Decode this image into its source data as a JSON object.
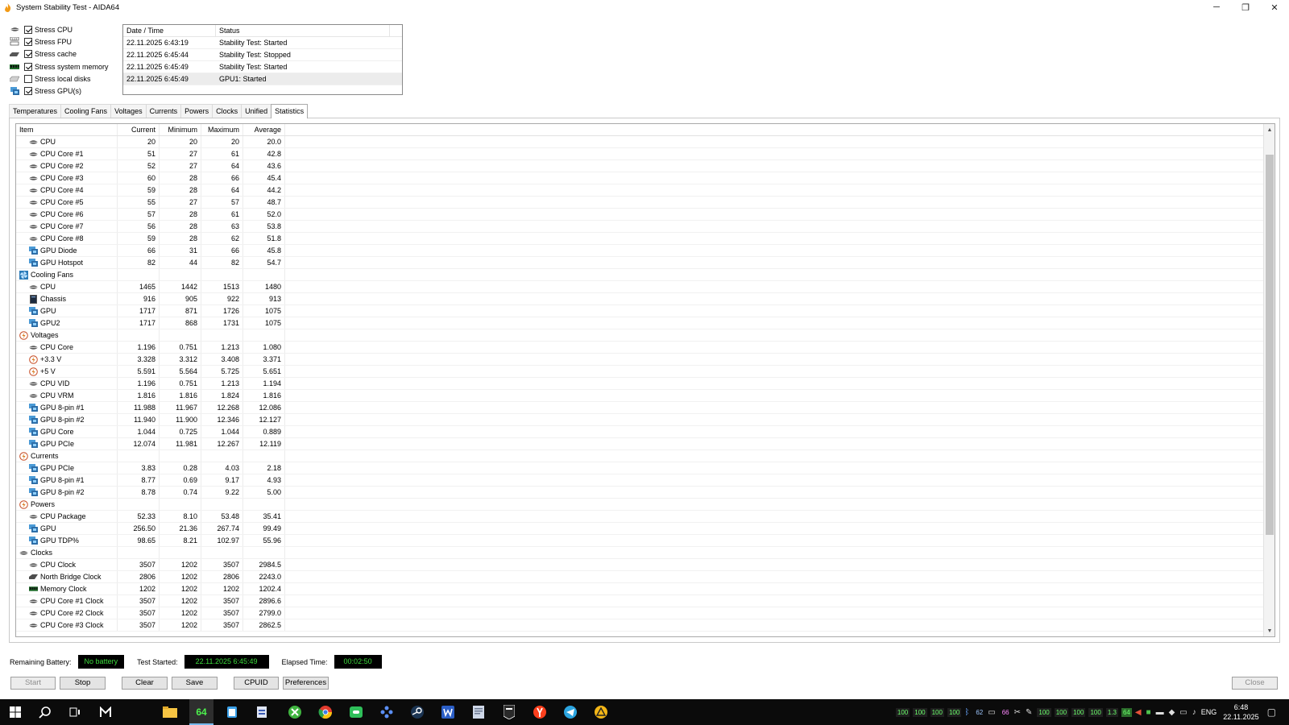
{
  "window": {
    "title": "System Stability Test - AIDA64",
    "minimize_glyph": "─",
    "restore_glyph": "❐",
    "close_glyph": "✕"
  },
  "stress_options": [
    {
      "label": "Stress CPU",
      "checked": true,
      "icon": "cpu-icon"
    },
    {
      "label": "Stress FPU",
      "checked": true,
      "icon": "fpu-icon"
    },
    {
      "label": "Stress cache",
      "checked": true,
      "icon": "cache-icon"
    },
    {
      "label": "Stress system memory",
      "checked": true,
      "icon": "memory-icon"
    },
    {
      "label": "Stress local disks",
      "checked": false,
      "icon": "disk-icon"
    },
    {
      "label": "Stress GPU(s)",
      "checked": true,
      "icon": "gpu-icon"
    }
  ],
  "log": {
    "headers": [
      "Date / Time",
      "Status"
    ],
    "rows": [
      {
        "datetime": "22.11.2025 6:43:19",
        "status": "Stability Test: Started"
      },
      {
        "datetime": "22.11.2025 6:45:44",
        "status": "Stability Test: Stopped"
      },
      {
        "datetime": "22.11.2025 6:45:49",
        "status": "Stability Test: Started"
      },
      {
        "datetime": "22.11.2025 6:45:49",
        "status": "GPU1: Started"
      }
    ]
  },
  "tabs": [
    "Temperatures",
    "Cooling Fans",
    "Voltages",
    "Currents",
    "Powers",
    "Clocks",
    "Unified",
    "Statistics"
  ],
  "active_tab": "Statistics",
  "stats": {
    "headers": {
      "item": "Item",
      "current": "Current",
      "minimum": "Minimum",
      "maximum": "Maximum",
      "average": "Average"
    },
    "rows": [
      {
        "name": "CPU",
        "level": 1,
        "icon": "cpu-icon",
        "cur": "20",
        "min": "20",
        "max": "20",
        "avg": "20.0"
      },
      {
        "name": "CPU Core #1",
        "level": 1,
        "icon": "cpu-icon",
        "cur": "51",
        "min": "27",
        "max": "61",
        "avg": "42.8"
      },
      {
        "name": "CPU Core #2",
        "level": 1,
        "icon": "cpu-icon",
        "cur": "52",
        "min": "27",
        "max": "64",
        "avg": "43.6"
      },
      {
        "name": "CPU Core #3",
        "level": 1,
        "icon": "cpu-icon",
        "cur": "60",
        "min": "28",
        "max": "66",
        "avg": "45.4"
      },
      {
        "name": "CPU Core #4",
        "level": 1,
        "icon": "cpu-icon",
        "cur": "59",
        "min": "28",
        "max": "64",
        "avg": "44.2"
      },
      {
        "name": "CPU Core #5",
        "level": 1,
        "icon": "cpu-icon",
        "cur": "55",
        "min": "27",
        "max": "57",
        "avg": "48.7"
      },
      {
        "name": "CPU Core #6",
        "level": 1,
        "icon": "cpu-icon",
        "cur": "57",
        "min": "28",
        "max": "61",
        "avg": "52.0"
      },
      {
        "name": "CPU Core #7",
        "level": 1,
        "icon": "cpu-icon",
        "cur": "56",
        "min": "28",
        "max": "63",
        "avg": "53.8"
      },
      {
        "name": "CPU Core #8",
        "level": 1,
        "icon": "cpu-icon",
        "cur": "59",
        "min": "28",
        "max": "62",
        "avg": "51.8"
      },
      {
        "name": "GPU Diode",
        "level": 1,
        "icon": "gpu-icon",
        "cur": "66",
        "min": "31",
        "max": "66",
        "avg": "45.8"
      },
      {
        "name": "GPU Hotspot",
        "level": 1,
        "icon": "gpu-icon",
        "cur": "82",
        "min": "44",
        "max": "82",
        "avg": "54.7"
      },
      {
        "name": "Cooling Fans",
        "level": 0,
        "icon": "fan-icon",
        "cur": "",
        "min": "",
        "max": "",
        "avg": ""
      },
      {
        "name": "CPU",
        "level": 1,
        "icon": "cpu-icon",
        "cur": "1465",
        "min": "1442",
        "max": "1513",
        "avg": "1480"
      },
      {
        "name": "Chassis",
        "level": 1,
        "icon": "chassis-icon",
        "cur": "916",
        "min": "905",
        "max": "922",
        "avg": "913"
      },
      {
        "name": "GPU",
        "level": 1,
        "icon": "gpu-icon",
        "cur": "1717",
        "min": "871",
        "max": "1726",
        "avg": "1075"
      },
      {
        "name": "GPU2",
        "level": 1,
        "icon": "gpu-icon",
        "cur": "1717",
        "min": "868",
        "max": "1731",
        "avg": "1075"
      },
      {
        "name": "Voltages",
        "level": 0,
        "icon": "voltage-icon",
        "cur": "",
        "min": "",
        "max": "",
        "avg": ""
      },
      {
        "name": "CPU Core",
        "level": 1,
        "icon": "cpu-icon",
        "cur": "1.196",
        "min": "0.751",
        "max": "1.213",
        "avg": "1.080"
      },
      {
        "name": "+3.3 V",
        "level": 1,
        "icon": "voltage-icon",
        "cur": "3.328",
        "min": "3.312",
        "max": "3.408",
        "avg": "3.371"
      },
      {
        "name": "+5 V",
        "level": 1,
        "icon": "voltage-icon",
        "cur": "5.591",
        "min": "5.564",
        "max": "5.725",
        "avg": "5.651"
      },
      {
        "name": "CPU VID",
        "level": 1,
        "icon": "cpu-icon",
        "cur": "1.196",
        "min": "0.751",
        "max": "1.213",
        "avg": "1.194"
      },
      {
        "name": "CPU VRM",
        "level": 1,
        "icon": "cpu-icon",
        "cur": "1.816",
        "min": "1.816",
        "max": "1.824",
        "avg": "1.816"
      },
      {
        "name": "GPU 8-pin #1",
        "level": 1,
        "icon": "gpu-icon",
        "cur": "11.988",
        "min": "11.967",
        "max": "12.268",
        "avg": "12.086"
      },
      {
        "name": "GPU 8-pin #2",
        "level": 1,
        "icon": "gpu-icon",
        "cur": "11.940",
        "min": "11.900",
        "max": "12.346",
        "avg": "12.127"
      },
      {
        "name": "GPU Core",
        "level": 1,
        "icon": "gpu-icon",
        "cur": "1.044",
        "min": "0.725",
        "max": "1.044",
        "avg": "0.889"
      },
      {
        "name": "GPU PCIe",
        "level": 1,
        "icon": "gpu-icon",
        "cur": "12.074",
        "min": "11.981",
        "max": "12.267",
        "avg": "12.119"
      },
      {
        "name": "Currents",
        "level": 0,
        "icon": "voltage-icon",
        "cur": "",
        "min": "",
        "max": "",
        "avg": ""
      },
      {
        "name": "GPU PCIe",
        "level": 1,
        "icon": "gpu-icon",
        "cur": "3.83",
        "min": "0.28",
        "max": "4.03",
        "avg": "2.18"
      },
      {
        "name": "GPU 8-pin #1",
        "level": 1,
        "icon": "gpu-icon",
        "cur": "8.77",
        "min": "0.69",
        "max": "9.17",
        "avg": "4.93"
      },
      {
        "name": "GPU 8-pin #2",
        "level": 1,
        "icon": "gpu-icon",
        "cur": "8.78",
        "min": "0.74",
        "max": "9.22",
        "avg": "5.00"
      },
      {
        "name": "Powers",
        "level": 0,
        "icon": "voltage-icon",
        "cur": "",
        "min": "",
        "max": "",
        "avg": ""
      },
      {
        "name": "CPU Package",
        "level": 1,
        "icon": "cpu-icon",
        "cur": "52.33",
        "min": "8.10",
        "max": "53.48",
        "avg": "35.41"
      },
      {
        "name": "GPU",
        "level": 1,
        "icon": "gpu-icon",
        "cur": "256.50",
        "min": "21.36",
        "max": "267.74",
        "avg": "99.49"
      },
      {
        "name": "GPU TDP%",
        "level": 1,
        "icon": "gpu-icon",
        "cur": "98.65",
        "min": "8.21",
        "max": "102.97",
        "avg": "55.96"
      },
      {
        "name": "Clocks",
        "level": 0,
        "icon": "cpu-icon",
        "cur": "",
        "min": "",
        "max": "",
        "avg": ""
      },
      {
        "name": "CPU Clock",
        "level": 1,
        "icon": "cpu-icon",
        "cur": "3507",
        "min": "1202",
        "max": "3507",
        "avg": "2984.5"
      },
      {
        "name": "North Bridge Clock",
        "level": 1,
        "icon": "chip-icon",
        "cur": "2806",
        "min": "1202",
        "max": "2806",
        "avg": "2243.0"
      },
      {
        "name": "Memory Clock",
        "level": 1,
        "icon": "memory-icon",
        "cur": "1202",
        "min": "1202",
        "max": "1202",
        "avg": "1202.4"
      },
      {
        "name": "CPU Core #1 Clock",
        "level": 1,
        "icon": "cpu-icon",
        "cur": "3507",
        "min": "1202",
        "max": "3507",
        "avg": "2896.6"
      },
      {
        "name": "CPU Core #2 Clock",
        "level": 1,
        "icon": "cpu-icon",
        "cur": "3507",
        "min": "1202",
        "max": "3507",
        "avg": "2799.0"
      },
      {
        "name": "CPU Core #3 Clock",
        "level": 1,
        "icon": "cpu-icon",
        "cur": "3507",
        "min": "1202",
        "max": "3507",
        "avg": "2862.5"
      }
    ]
  },
  "status": {
    "battery_label": "Remaining Battery:",
    "battery_value": "No battery",
    "started_label": "Test Started:",
    "started_value": "22.11.2025 6:45:49",
    "elapsed_label": "Elapsed Time:",
    "elapsed_value": "00:02:50"
  },
  "buttons": {
    "start": "Start",
    "stop": "Stop",
    "clear": "Clear",
    "save": "Save",
    "cpuid": "CPUID",
    "preferences": "Preferences",
    "close": "Close"
  },
  "taskbar": {
    "apps": [
      "windows-start-icon",
      "search-icon",
      "task-view-icon",
      "app-m-icon",
      "file-explorer-icon",
      "aida64-icon",
      "notepad-icon",
      "document-icon",
      "xbox-icon",
      "chrome-icon",
      "gamepad-icon",
      "dots-icon",
      "steam-icon",
      "word-icon",
      "file-icon",
      "epic-games-icon",
      "yandex-icon",
      "telegram-icon",
      "warning-icon"
    ],
    "active_app": "aida64-icon",
    "aida_label": "64",
    "tray_values": [
      "100",
      "100",
      "100",
      "100",
      "62",
      "66",
      "100",
      "100",
      "100",
      "100",
      "1.3",
      "64"
    ],
    "language": "ENG",
    "time": "6:48",
    "date": "22.11.2025"
  },
  "colors": {
    "status_text": "#3cdc3c",
    "status_bg": "#000000",
    "taskbar_bg": "#0b0b0b",
    "selection": "#ececec"
  }
}
